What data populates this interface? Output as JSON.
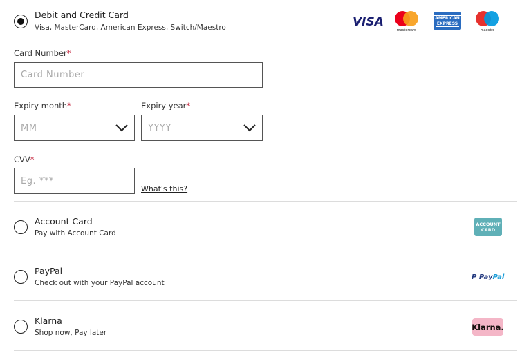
{
  "payment_methods": [
    {
      "title": "Debit and Credit Card",
      "subtitle": "Visa, MasterCard, American Express, Switch/Maestro",
      "selected": true,
      "logos": [
        "visa-logo",
        "mastercard-logo",
        "american-express-logo",
        "maestro-logo"
      ]
    },
    {
      "title": "Account Card",
      "subtitle": "Pay with Account Card",
      "selected": false,
      "logos": [
        "account-card-logo"
      ]
    },
    {
      "title": "PayPal",
      "subtitle": "Check out with your PayPal account",
      "selected": false,
      "logos": [
        "paypal-logo"
      ]
    },
    {
      "title": "Klarna",
      "subtitle": "Shop now, Pay later",
      "selected": false,
      "logos": [
        "klarna-logo"
      ]
    }
  ],
  "logo_text": {
    "visa": "VISA",
    "mastercard": "mastercard",
    "maestro": "maestro",
    "amex_line1": "AMERICAN",
    "amex_line2": "EXPRESS",
    "account_line1": "ACCOUNT",
    "account_line2": "CARD",
    "paypal_pay": "Pay",
    "paypal_pal": "Pal",
    "klarna": "Klarna."
  },
  "card_form": {
    "required_marker": "*",
    "card_number": {
      "label": "Card Number",
      "placeholder": "Card Number",
      "value": ""
    },
    "expiry_month": {
      "label": "Expiry month",
      "placeholder": "MM",
      "value": ""
    },
    "expiry_year": {
      "label": "Expiry year",
      "placeholder": "YYYY",
      "value": ""
    },
    "cvv": {
      "label": "CVV",
      "placeholder": "Eg. ***",
      "value": ""
    },
    "cvv_help_link": "What's this?"
  },
  "colors": {
    "required": "#c0152f",
    "visa": "#1a1f71",
    "mastercard_red": "#eb001b",
    "mastercard_orange": "#f79e1b",
    "maestro_blue": "#0099df",
    "amex": "#2a6cc0",
    "account_card": "#5fb0b7",
    "paypal_dark": "#253b80",
    "paypal_light": "#179bd7",
    "klarna": "#f4b6c7"
  }
}
